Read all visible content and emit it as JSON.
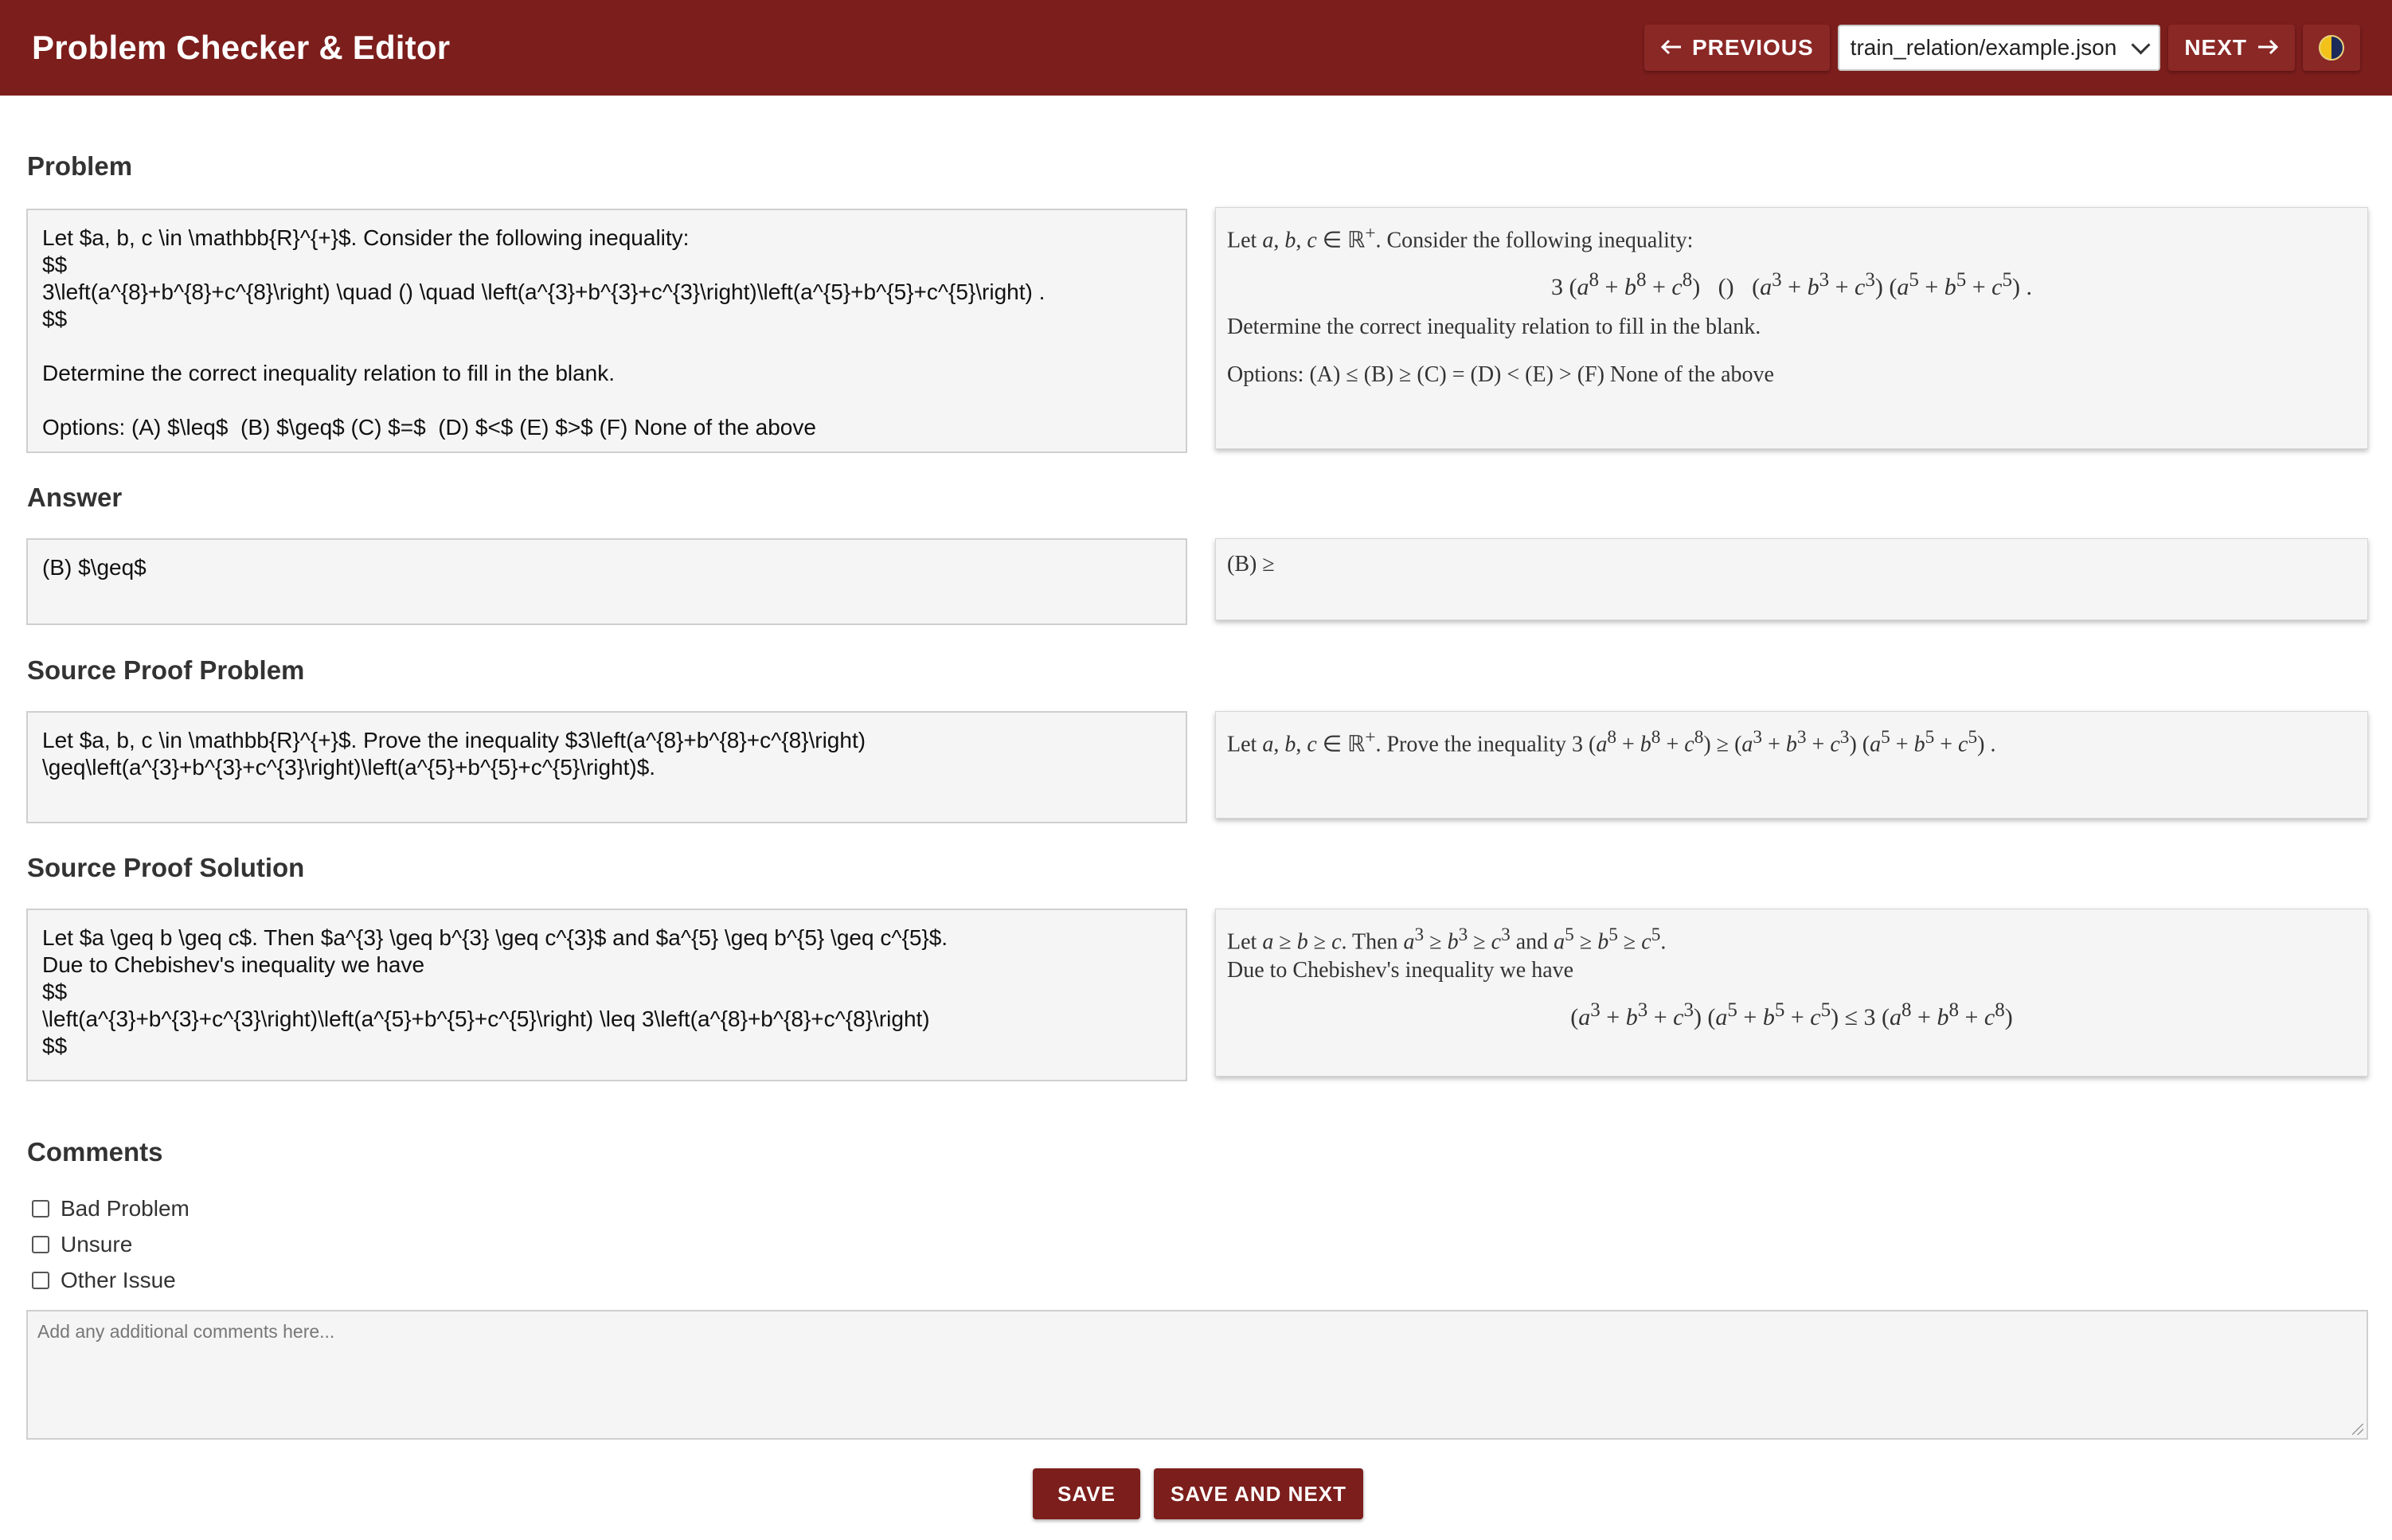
{
  "header": {
    "title": "Problem Checker & Editor",
    "prev_label": "PREVIOUS",
    "next_label": "NEXT",
    "file_select": "train_relation/example.json",
    "colors": {
      "brand": "#7c1e1c"
    }
  },
  "sections": {
    "problem": {
      "title": "Problem",
      "source": "Let $a, b, c \\in \\mathbb{R}^{+}$. Consider the following inequality:\n$$\n3\\left(a^{8}+b^{8}+c^{8}\\right) \\quad () \\quad \\left(a^{3}+b^{3}+c^{3}\\right)\\left(a^{5}+b^{5}+c^{5}\\right) .\n$$\n\nDetermine the correct inequality relation to fill in the blank.\n\nOptions: (A) $\\leq$  (B) $\\geq$ (C) $=$  (D) $<$ (E) $>$ (F) None of the above",
      "rendered_intro": "Consider the following inequality:",
      "rendered_question": "Determine the correct inequality relation to fill in the blank.",
      "rendered_options": "Options: (A) ≤ (B) ≥ (C) = (D) < (E) > (F) None of the above"
    },
    "answer": {
      "title": "Answer",
      "source": "(B) $\\geq$",
      "rendered": "(B) ≥"
    },
    "source_problem": {
      "title": "Source Proof Problem",
      "source": "Let $a, b, c \\in \\mathbb{R}^{+}$. Prove the inequality $3\\left(a^{8}+b^{8}+c^{8}\\right)\n\\geq\\left(a^{3}+b^{3}+c^{3}\\right)\\left(a^{5}+b^{5}+c^{5}\\right)$.",
      "rendered_mid": "Prove the inequality"
    },
    "source_solution": {
      "title": "Source Proof Solution",
      "source": "Let $a \\geq b \\geq c$. Then $a^{3} \\geq b^{3} \\geq c^{3}$ and $a^{5} \\geq b^{5} \\geq c^{5}$.\nDue to Chebishev's inequality we have\n$$\n\\left(a^{3}+b^{3}+c^{3}\\right)\\left(a^{5}+b^{5}+c^{5}\\right) \\leq 3\\left(a^{8}+b^{8}+c^{8}\\right)\n$$",
      "rendered_and": "and",
      "rendered_line2": "Due to Chebishev's inequality we have"
    }
  },
  "comments": {
    "title": "Comments",
    "checkboxes": [
      "Bad Problem",
      "Unsure",
      "Other Issue"
    ],
    "placeholder": "Add any additional comments here..."
  },
  "actions": {
    "save": "SAVE",
    "save_next": "SAVE AND NEXT"
  }
}
